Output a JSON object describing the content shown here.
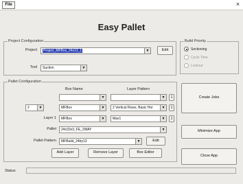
{
  "menu": {
    "file_label": "File",
    "close_symbol": "×"
  },
  "app_title": "Easy Pallet",
  "project_config": {
    "title": "Project Configuration",
    "project_label": "Project",
    "project_value": "Project_MFBox_24x13_1",
    "edit_label": "Edit",
    "tool_label": "Tool",
    "tool_value": "Suction"
  },
  "build_priority": {
    "title": "Build Priority",
    "options": [
      {
        "label": "Sectioning",
        "selected": true,
        "enabled": true
      },
      {
        "label": "Cycle Time",
        "selected": false,
        "enabled": false
      },
      {
        "label": "Lockout",
        "selected": false,
        "enabled": false
      }
    ]
  },
  "pallet_config": {
    "title": "Pallet Configuration",
    "box_name_header": "Box Name",
    "layer_pattern_header": "Layer Pattern",
    "layer_count_value": "2",
    "layer_label": "Layer 1",
    "row1": {
      "box_value": "",
      "pattern_value": "",
      "stepper": "1"
    },
    "row2": {
      "box_value": "MFBox",
      "pattern_value": "2 Vertical Rows, Basic Hor",
      "stepper": "1"
    },
    "row3": {
      "box_value": "MFBox",
      "pattern_value": "Max1",
      "stepper": "1"
    },
    "pallet_label": "Pallet",
    "pallet_value": "24x33x3_FE_2WAY",
    "pallet_pattern_label": "Pallet Pattern",
    "pallet_pattern_value": "MFBuild_24by13",
    "edit_label": "Edit",
    "add_layer_label": "Add Layer",
    "remove_layer_label": "Remove Layer",
    "box_editor_label": "Box Editor"
  },
  "side_buttons": {
    "create_jobs": "Create Jobs",
    "minimize_app": "Minimize App",
    "close_app": "Close App"
  },
  "status": {
    "label": "Status",
    "value": ""
  }
}
